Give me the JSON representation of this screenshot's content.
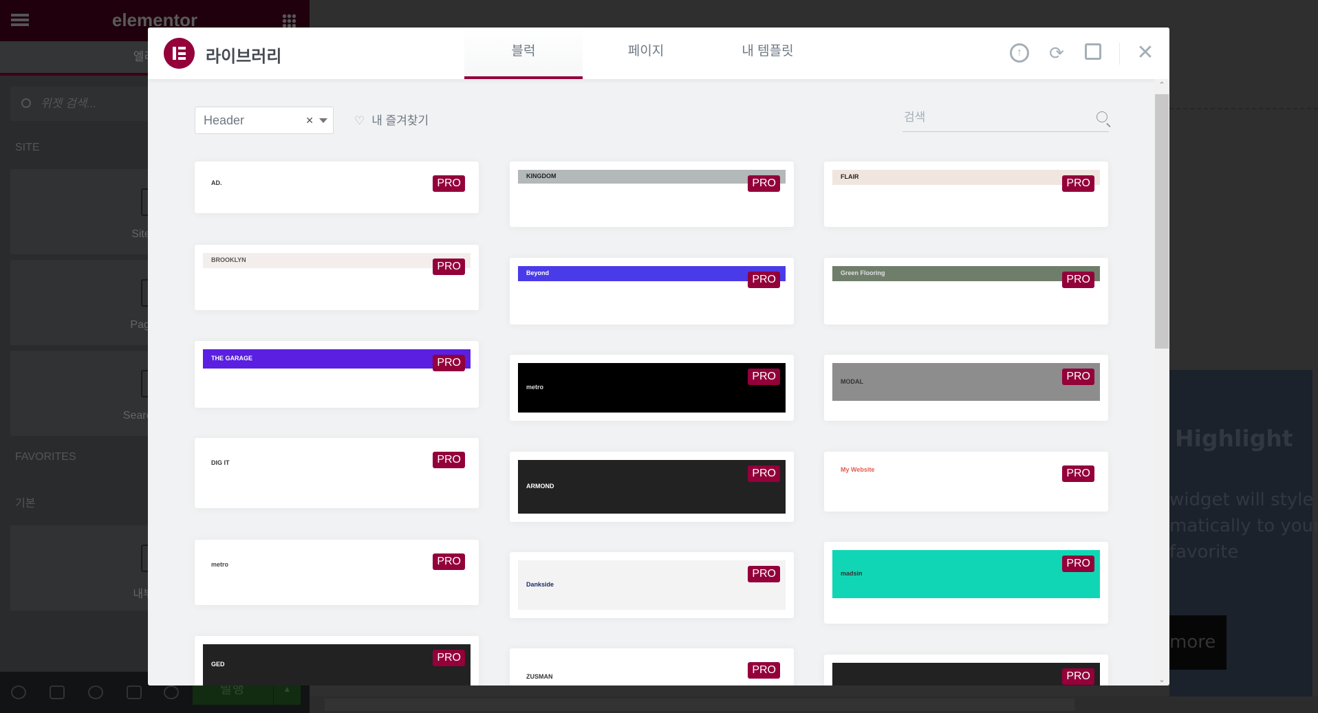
{
  "editor": {
    "logo": "elementor",
    "elements_tab": "엘리멘츠",
    "search_placeholder": "위젯 검색...",
    "site_section": "SITE",
    "site_widgets": [
      "Site Logo",
      "Page Title",
      "Search Form"
    ],
    "favorites_section": "FAVORITES",
    "basic_section": "기본",
    "basic_widgets": [
      "내부 섹션"
    ],
    "publish_label": "발행"
  },
  "preview": {
    "heading": "Highlight",
    "text": "widget will style matically to your favorite",
    "button": "more"
  },
  "library": {
    "title": "라이브러리",
    "tabs": [
      {
        "label": "블럭",
        "active": true
      },
      {
        "label": "페이지",
        "active": false
      },
      {
        "label": "내 템플릿",
        "active": false
      }
    ],
    "actions": [
      "upload-icon",
      "sync-icon",
      "save-icon",
      "close-icon"
    ],
    "filter_value": "Header",
    "favorites_label": "내 즐겨찾기",
    "search_placeholder": "검색",
    "pro_label": "PRO",
    "accent": "#93003a",
    "columns": [
      [
        {
          "name": "AD.",
          "bg": "#ffffff",
          "fg": "#333333"
        },
        {
          "name": "BROOKLYN",
          "bg": "#f3eeec",
          "fg": "#555555"
        },
        {
          "name": "THE GARAGE",
          "bg": "#5a1fe0",
          "fg": "#ffffff"
        },
        {
          "name": "DIG IT",
          "bg": "#ffffff",
          "fg": "#333333"
        },
        {
          "name": "metro",
          "bg": "#ffffff",
          "fg": "#444444"
        },
        {
          "name": "GED",
          "bg": "#222222",
          "fg": "#ffffff"
        }
      ],
      [
        {
          "name": "KINGDOM",
          "bg": "#b3b8b9",
          "fg": "#222222"
        },
        {
          "name": "Beyond",
          "bg": "#4a3be8",
          "fg": "#ffffff"
        },
        {
          "name": "metro",
          "bg": "#000000",
          "fg": "#dddddd"
        },
        {
          "name": "ARMOND",
          "bg": "#222222",
          "fg": "#ffffff"
        },
        {
          "name": "Dankside",
          "bg": "#f3f3f3",
          "fg": "#1d2a6b"
        },
        {
          "name": "ZUSMAN",
          "bg": "#ffffff",
          "fg": "#333333"
        }
      ],
      [
        {
          "name": "FLAIR",
          "bg": "#f0e6df",
          "fg": "#222222"
        },
        {
          "name": "Green Flooring",
          "bg": "#6f7e6a",
          "fg": "#e0e0e0"
        },
        {
          "name": "MODAL",
          "bg": "#8d8d8d",
          "fg": "#333333"
        },
        {
          "name": "My Website",
          "bg": "#ffffff",
          "fg": "#e25a4b"
        },
        {
          "name": "madsin",
          "bg": "#11d6b5",
          "fg": "#333333"
        },
        {
          "name": "",
          "bg": "#222222",
          "fg": "#ffffff"
        }
      ]
    ]
  }
}
